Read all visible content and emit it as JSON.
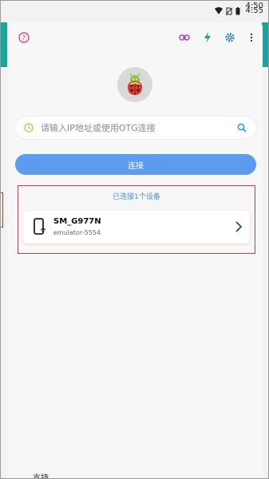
{
  "status_bar": {
    "time_primary": "4:50",
    "time_secondary": "4:55"
  },
  "search": {
    "placeholder": "请输入IP地址或使用OTG连接"
  },
  "connect_button": {
    "label": "连接"
  },
  "devices": {
    "summary": "已连接1个设备",
    "items": [
      {
        "name": "SM_G977N",
        "serial": "emulator-5554"
      }
    ]
  },
  "bottom_peek": {
    "text": "支持"
  },
  "colors": {
    "accent_blue": "#5b9cf0",
    "highlight_red": "#e0393b",
    "help_icon": "#e84a72",
    "link_icon": "#a043c8",
    "flash_icon": "#1a9e8a",
    "gear_icon": "#2a7ed8"
  },
  "icons": [
    "help-icon",
    "link-icon",
    "flash-icon",
    "gear-icon",
    "more-icon",
    "history-icon",
    "search-icon",
    "phone-wifi-icon",
    "chevron-right-icon"
  ]
}
